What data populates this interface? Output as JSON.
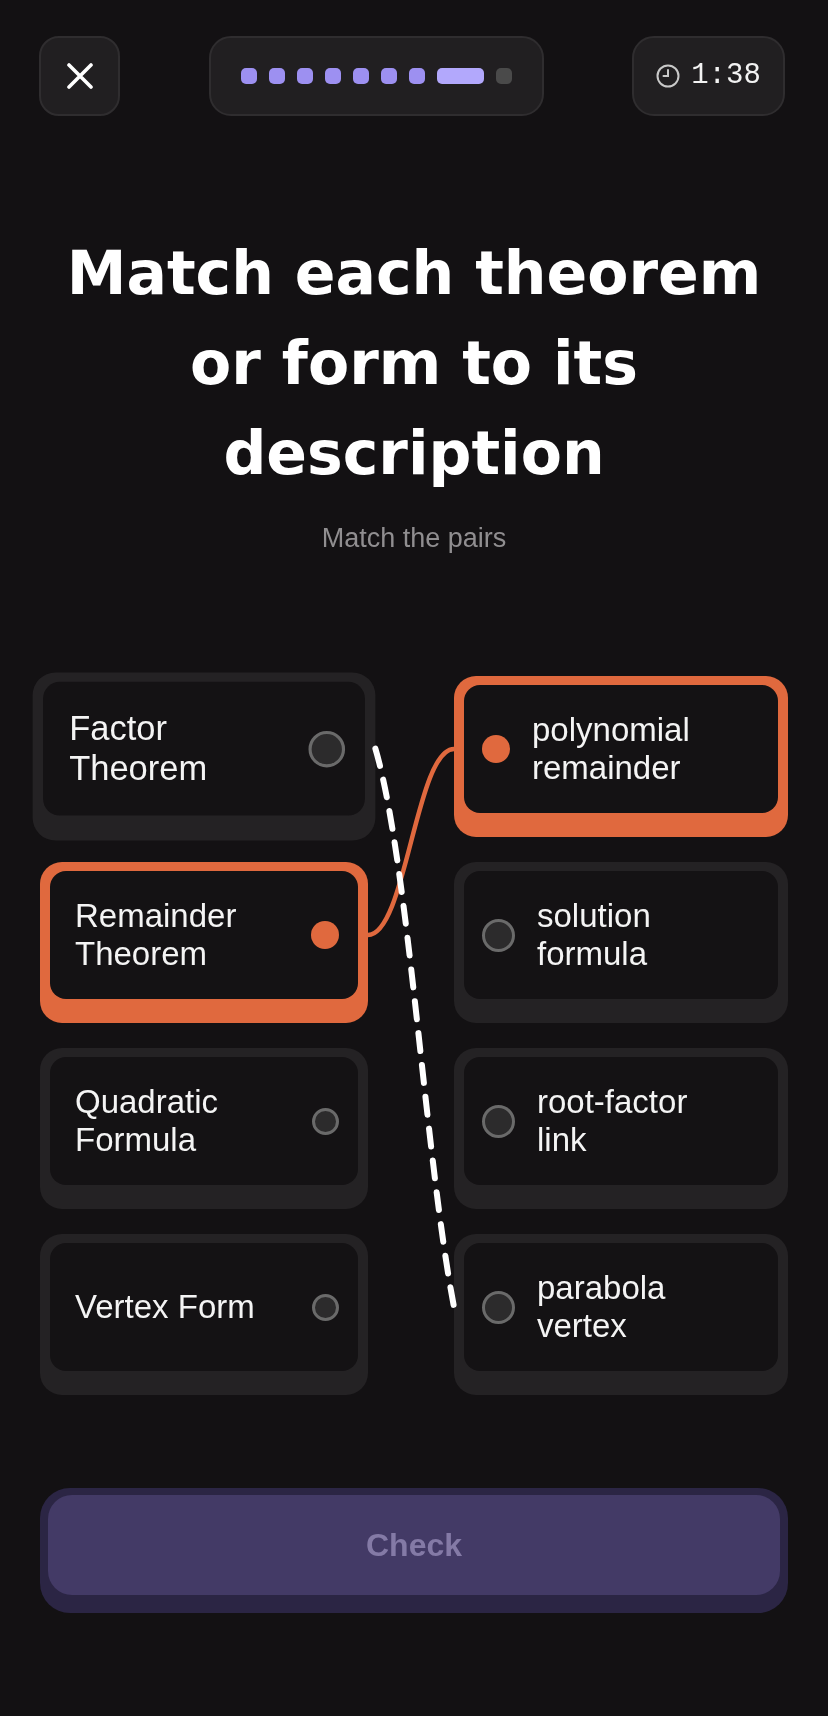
{
  "progress": {
    "segments": [
      {
        "done": true,
        "current": false
      },
      {
        "done": true,
        "current": false
      },
      {
        "done": true,
        "current": false
      },
      {
        "done": true,
        "current": false
      },
      {
        "done": true,
        "current": false
      },
      {
        "done": true,
        "current": false
      },
      {
        "done": true,
        "current": false
      },
      {
        "done": false,
        "current": true
      },
      {
        "done": false,
        "current": false
      }
    ]
  },
  "timer": {
    "text": "1:38"
  },
  "title": "Match each theorem or form to its description",
  "subtitle": "Match the pairs",
  "left_items": [
    {
      "label": "Factor Theorem",
      "selected": true
    },
    {
      "label": "Remainder Theorem",
      "selected": false,
      "color": "#e0693e"
    },
    {
      "label": "Quadratic Formula",
      "selected": false
    },
    {
      "label": "Vertex Form",
      "selected": false
    }
  ],
  "right_items": [
    {
      "label": "polynomial remainder",
      "selected": false,
      "targeted": false,
      "color": "#e0693e"
    },
    {
      "label": "solution formula",
      "selected": false,
      "targeted": false
    },
    {
      "label": "root-factor link",
      "selected": false,
      "targeted": false
    },
    {
      "label": "parabola vertex",
      "selected": false,
      "targeted": true
    }
  ],
  "check_button": {
    "label": "Check",
    "disabled": true
  }
}
